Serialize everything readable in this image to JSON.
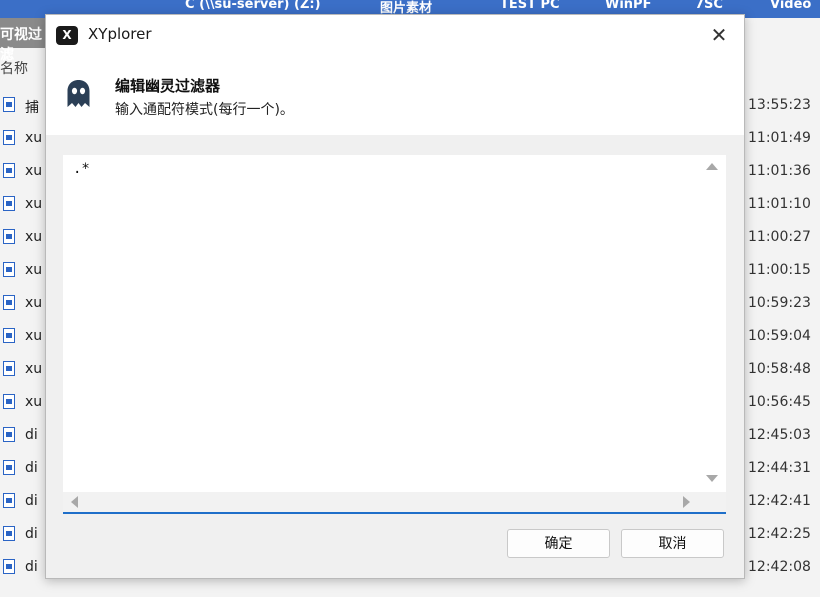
{
  "background": {
    "breadcrumbs": [
      "C (\\\\su-server) (Z:)",
      "图片素材",
      "TEST PC",
      "WinPF",
      "7SC",
      "Video"
    ],
    "panel_label": "可视过滤",
    "column_header": "名称",
    "files": [
      {
        "name": "捕",
        "time": "13:55:23"
      },
      {
        "name": "xu",
        "time": "11:01:49"
      },
      {
        "name": "xu",
        "time": "11:01:36"
      },
      {
        "name": "xu",
        "time": "11:01:10"
      },
      {
        "name": "xu",
        "time": "11:00:27"
      },
      {
        "name": "xu",
        "time": "11:00:15"
      },
      {
        "name": "xu",
        "time": "10:59:23"
      },
      {
        "name": "xu",
        "time": "10:59:04"
      },
      {
        "name": "xu",
        "time": "10:58:48"
      },
      {
        "name": "xu",
        "time": "10:56:45"
      },
      {
        "name": "di",
        "time": "12:45:03"
      },
      {
        "name": "di",
        "time": "12:44:31"
      },
      {
        "name": "di",
        "time": "12:42:41"
      },
      {
        "name": "di",
        "time": "12:42:25"
      },
      {
        "name": "di",
        "time": "12:42:08"
      }
    ]
  },
  "dialog": {
    "app_icon_text": "X",
    "title": "XYplorer",
    "close_glyph": "✕",
    "header_title": "编辑幽灵过滤器",
    "header_subtitle": "输入通配符模式(每行一个)。",
    "editor_text": ".*",
    "ok_label": "确定",
    "cancel_label": "取消",
    "accent_color": "#1f6fc9"
  }
}
